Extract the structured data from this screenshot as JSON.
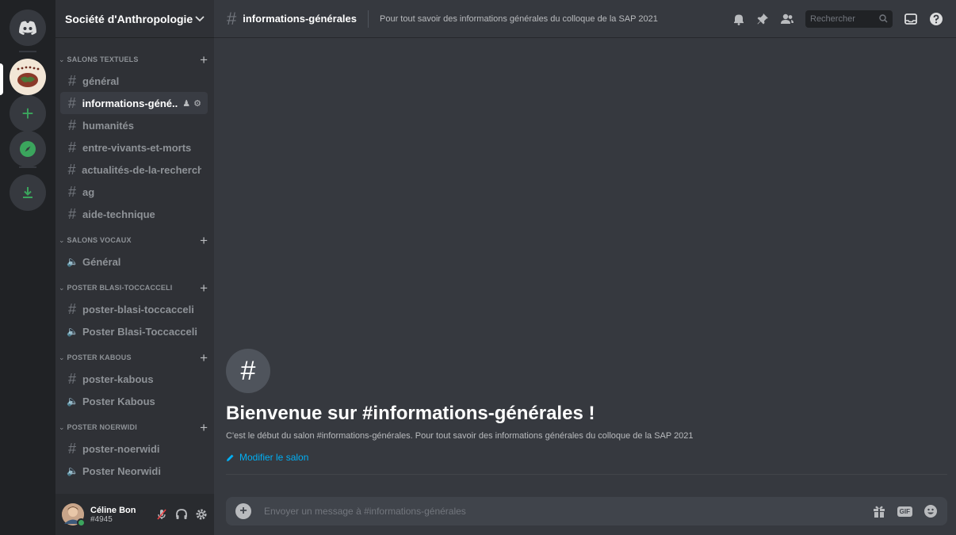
{
  "server": {
    "name": "Société d'Anthropologie ...",
    "categories": [
      {
        "name": "SALONS TEXTUELS",
        "channels": [
          {
            "type": "text",
            "label": "général"
          },
          {
            "type": "text",
            "label": "informations-géné...",
            "active": true
          },
          {
            "type": "text",
            "label": "humanités"
          },
          {
            "type": "text",
            "label": "entre-vivants-et-morts"
          },
          {
            "type": "text",
            "label": "actualités-de-la-recherche"
          },
          {
            "type": "text",
            "label": "ag"
          },
          {
            "type": "text",
            "label": "aide-technique"
          }
        ]
      },
      {
        "name": "SALONS VOCAUX",
        "channels": [
          {
            "type": "voice",
            "label": "Général"
          }
        ]
      },
      {
        "name": "POSTER BLASI-TOCCACCELI",
        "channels": [
          {
            "type": "text",
            "label": "poster-blasi-toccacceli"
          },
          {
            "type": "voice",
            "label": "Poster Blasi-Toccacceli"
          }
        ]
      },
      {
        "name": "POSTER KABOUS",
        "channels": [
          {
            "type": "text",
            "label": "poster-kabous"
          },
          {
            "type": "voice",
            "label": "Poster Kabous"
          }
        ]
      },
      {
        "name": "POSTER NOERWIDI",
        "channels": [
          {
            "type": "text",
            "label": "poster-noerwidi"
          },
          {
            "type": "voice",
            "label": "Poster Neorwidi"
          }
        ]
      }
    ]
  },
  "user": {
    "name": "Céline Bon",
    "tag": "#4945"
  },
  "channel": {
    "hash": "#",
    "name": "informations-générales",
    "topic": "Pour tout savoir des informations générales du colloque de la SAP 2021"
  },
  "search": {
    "placeholder": "Rechercher"
  },
  "welcome": {
    "title": "Bienvenue sur #informations-générales !",
    "description": "C'est le début du salon #informations-générales. Pour tout savoir des informations générales du colloque de la SAP 2021",
    "edit_label": "Modifier le salon"
  },
  "composer": {
    "placeholder": "Envoyer un message à #informations-générales",
    "gif_label": "GIF"
  },
  "colors": {
    "accent": "#5865f2",
    "link": "#00aff4",
    "online": "#3ba55d"
  },
  "icons": [
    "discord-logo-icon",
    "bell-icon",
    "pin-icon",
    "members-icon",
    "search-icon",
    "inbox-icon",
    "help-icon",
    "mute-icon",
    "headphones-icon",
    "gear-icon",
    "gift-icon",
    "emoji-icon",
    "pencil-icon",
    "download-icon",
    "compass-icon"
  ]
}
